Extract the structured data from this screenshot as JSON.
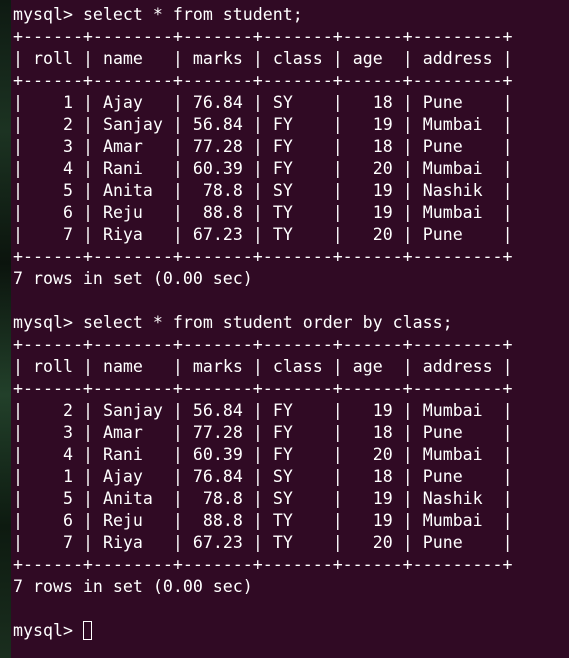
{
  "prompt": "mysql> ",
  "columns": [
    "roll",
    "name",
    "marks",
    "class",
    "age",
    "address"
  ],
  "queries": [
    {
      "command": "select * from student;",
      "rows": [
        [
          "1",
          "Ajay",
          "76.84",
          "SY",
          "18",
          "Pune"
        ],
        [
          "2",
          "Sanjay",
          "56.84",
          "FY",
          "19",
          "Mumbai"
        ],
        [
          "3",
          "Amar",
          "77.28",
          "FY",
          "18",
          "Pune"
        ],
        [
          "4",
          "Rani",
          "60.39",
          "FY",
          "20",
          "Mumbai"
        ],
        [
          "5",
          "Anita",
          "78.8",
          "SY",
          "19",
          "Nashik"
        ],
        [
          "6",
          "Reju",
          "88.8",
          "TY",
          "19",
          "Mumbai"
        ],
        [
          "7",
          "Riya",
          "67.23",
          "TY",
          "20",
          "Pune"
        ]
      ],
      "summary": "7 rows in set (0.00 sec)"
    },
    {
      "command": "select * from student order by class;",
      "rows": [
        [
          "2",
          "Sanjay",
          "56.84",
          "FY",
          "19",
          "Mumbai"
        ],
        [
          "3",
          "Amar",
          "77.28",
          "FY",
          "18",
          "Pune"
        ],
        [
          "4",
          "Rani",
          "60.39",
          "FY",
          "20",
          "Mumbai"
        ],
        [
          "1",
          "Ajay",
          "76.84",
          "SY",
          "18",
          "Pune"
        ],
        [
          "5",
          "Anita",
          "78.8",
          "SY",
          "19",
          "Nashik"
        ],
        [
          "6",
          "Reju",
          "88.8",
          "TY",
          "19",
          "Mumbai"
        ],
        [
          "7",
          "Riya",
          "67.23",
          "TY",
          "20",
          "Pune"
        ]
      ],
      "summary": "7 rows in set (0.00 sec)"
    }
  ],
  "colors": {
    "background": "#300a24",
    "text": "#ffffff"
  }
}
